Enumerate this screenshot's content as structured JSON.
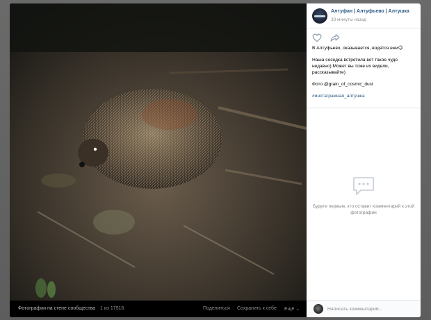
{
  "post": {
    "group_name": "Алтуфан | Алтуфьево | Алтушка",
    "time": "33 минуты назад",
    "text_line1": "В Алтуфьево, оказывается, водятся ежи😉",
    "text_line2": "Наша соседка встретила вот такое чудо недавно) Может вы тоже их видели, рассказывайте)",
    "text_line3": "Фото @grain_of_cosmic_dust",
    "hashtag": "#инстаграмная_алтушка",
    "like_icon": "heart-icon",
    "share_icon": "share-arrow-icon"
  },
  "comments": {
    "empty_text": "Будете первым, кто оставит комментарий к этой фотографии",
    "placeholder": "Написать комментарий...",
    "empty_icon": "comment-bubble-icon"
  },
  "photo_footer": {
    "album": "Фотографии на стене сообщества",
    "counter": "1 из 17516",
    "share": "Поделиться",
    "save": "Сохранить к себе",
    "more": "Ещё ⌄"
  },
  "colors": {
    "link": "#2a5885",
    "muted": "#939393",
    "overlay": "#5b5b5b"
  }
}
